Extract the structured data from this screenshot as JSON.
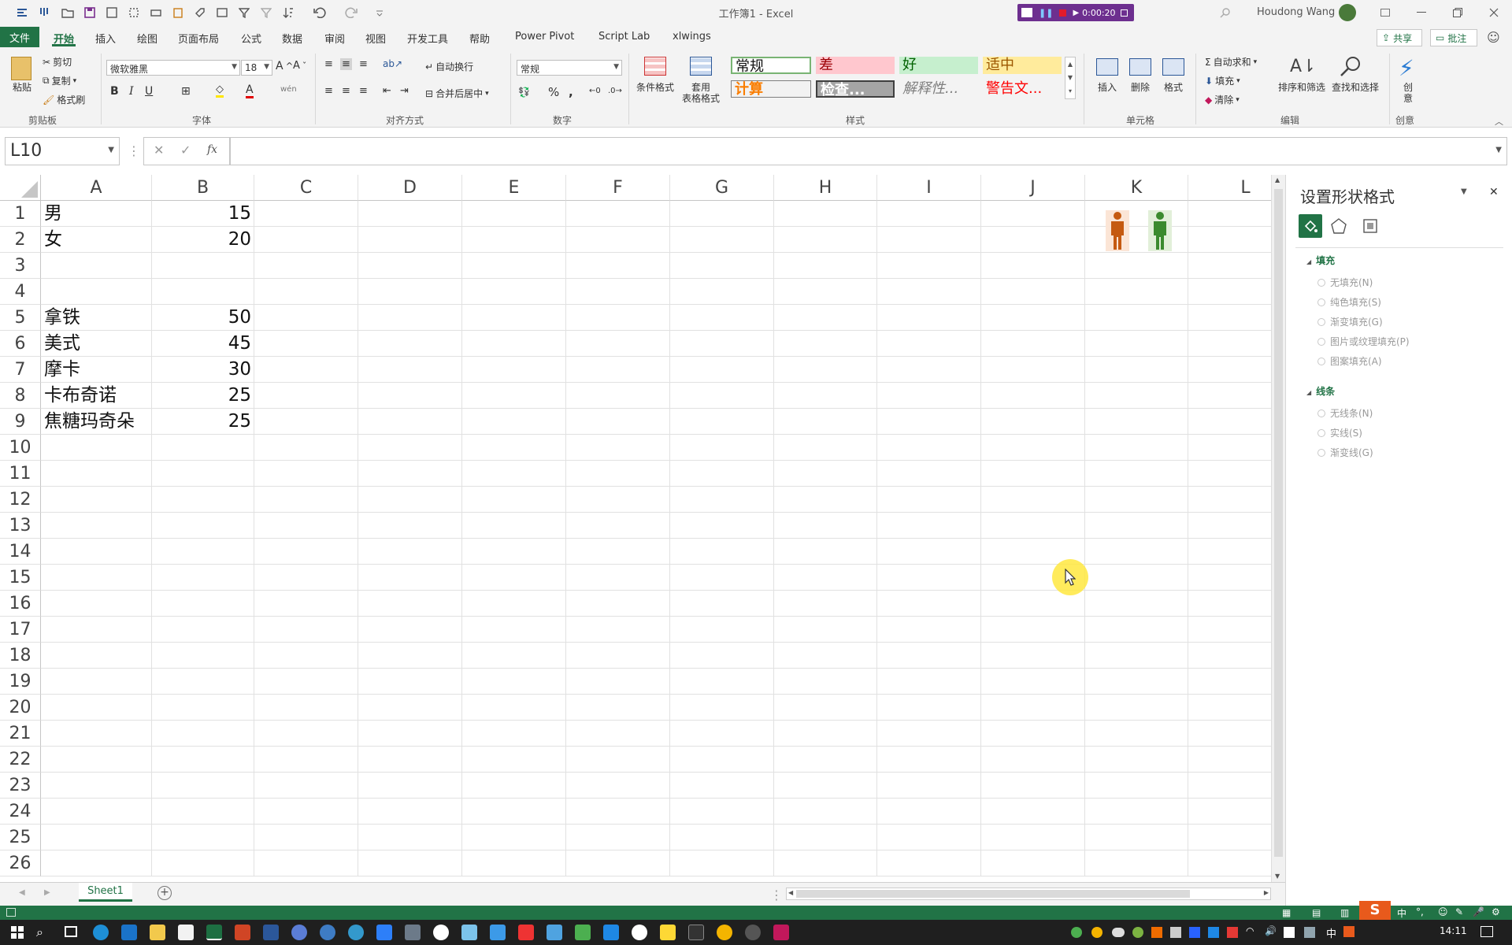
{
  "window": {
    "title": "工作簿1  -  Excel",
    "user": "Houdong Wang",
    "recording_time": "0:00:20"
  },
  "menu": {
    "file": "文件",
    "tabs": [
      "开始",
      "插入",
      "绘图",
      "页面布局",
      "公式",
      "数据",
      "审阅",
      "视图",
      "开发工具",
      "帮助",
      "Power Pivot",
      "Script Lab",
      "xlwings"
    ],
    "share": "共享",
    "comments": "批注"
  },
  "ribbon": {
    "clipboard": {
      "label": "剪贴板",
      "paste": "粘贴",
      "cut": "剪切",
      "copy": "复制",
      "format_painter": "格式刷"
    },
    "font": {
      "label": "字体",
      "name": "微软雅黑",
      "size": "18"
    },
    "alignment": {
      "label": "对齐方式",
      "wrap": "自动换行",
      "merge": "合并后居中"
    },
    "number": {
      "label": "数字",
      "format": "常规"
    },
    "styles": {
      "label": "样式",
      "cond_format": "条件格式",
      "table_format_1": "套用",
      "table_format_2": "表格格式",
      "cells": [
        "常规",
        "差",
        "好",
        "适中",
        "计算",
        "检查...",
        "解释性...",
        "警告文..."
      ]
    },
    "cells_group": {
      "label": "单元格",
      "insert": "插入",
      "delete": "删除",
      "format": "格式"
    },
    "editing": {
      "label": "编辑",
      "autosum": "自动求和",
      "fill": "填充",
      "clear": "清除",
      "sort": "排序和筛选",
      "find": "查找和选择"
    },
    "creative": {
      "label": "创意",
      "ideas_1": "创",
      "ideas_2": "意"
    }
  },
  "formula_bar": {
    "name_box": "L10",
    "fx": "fx",
    "value": ""
  },
  "grid": {
    "columns": [
      "A",
      "B",
      "C",
      "D",
      "E",
      "F",
      "G",
      "H",
      "I",
      "J",
      "K",
      "L"
    ],
    "rows": [
      "1",
      "2",
      "3",
      "4",
      "5",
      "6",
      "7",
      "8",
      "9",
      "10",
      "11",
      "12",
      "13",
      "14",
      "15",
      "16",
      "17",
      "18",
      "19",
      "20",
      "21",
      "22",
      "23",
      "24",
      "25",
      "26"
    ],
    "cells": [
      {
        "row": 1,
        "a": "男",
        "b": "15"
      },
      {
        "row": 2,
        "a": "女",
        "b": "20"
      },
      {
        "row": 5,
        "a": "拿铁",
        "b": "50"
      },
      {
        "row": 6,
        "a": "美式",
        "b": "45"
      },
      {
        "row": 7,
        "a": "摩卡",
        "b": "30"
      },
      {
        "row": 8,
        "a": "卡布奇诺",
        "b": "25"
      },
      {
        "row": 9,
        "a": "焦糖玛奇朵",
        "b": "25"
      }
    ],
    "shapes": [
      {
        "name": "male-figure",
        "color": "#c55a11"
      },
      {
        "name": "female-figure",
        "color": "#3b8a2e"
      }
    ]
  },
  "sheet_tabs": {
    "active": "Sheet1"
  },
  "format_panel": {
    "title": "设置形状格式",
    "fill_section": "填充",
    "fill_options": [
      "无填充(N)",
      "纯色填充(S)",
      "渐变填充(G)",
      "图片或纹理填充(P)",
      "图案填充(A)"
    ],
    "line_section": "线条",
    "line_options": [
      "无线条(N)",
      "实线(S)",
      "渐变线(G)"
    ]
  },
  "taskbar": {
    "time": "14:11",
    "ime": "中"
  },
  "colors": {
    "excel_green": "#217346",
    "rec_purple": "#6d2f8f"
  }
}
